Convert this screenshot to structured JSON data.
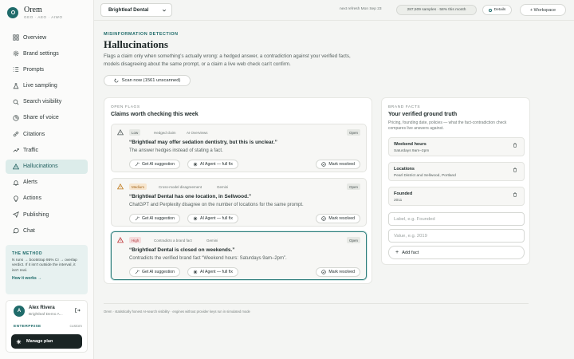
{
  "app": {
    "name": "Orem",
    "subtitle": "GEO · AEO · AIWO"
  },
  "nav": [
    {
      "label": "Overview",
      "icon": "grid-icon"
    },
    {
      "label": "Brand settings",
      "icon": "settings-icon"
    },
    {
      "label": "Prompts",
      "icon": "list-icon"
    },
    {
      "label": "Live sampling",
      "icon": "sampling-icon"
    },
    {
      "label": "Search visibility",
      "icon": "search-icon"
    },
    {
      "label": "Share of voice",
      "icon": "pie-icon"
    },
    {
      "label": "Citations",
      "icon": "link-icon"
    },
    {
      "label": "Traffic",
      "icon": "trend-icon"
    },
    {
      "label": "Hallucinations",
      "icon": "warning-icon",
      "active": true
    },
    {
      "label": "Alerts",
      "icon": "bell-icon"
    },
    {
      "label": "Actions",
      "icon": "bulb-icon"
    },
    {
      "label": "Publishing",
      "icon": "send-icon"
    },
    {
      "label": "Chat",
      "icon": "chat-icon"
    }
  ],
  "method": {
    "title": "THE METHOD",
    "text": "N runs → bootstrap 95% CI → overlap verdict. If it isn't outside the interval, it isn't real.",
    "link": "How it works →"
  },
  "account": {
    "initial": "A",
    "name": "Alex Rivera",
    "org": "Brightleaf Demo A...",
    "plan": "ENTERPRISE",
    "plan_type": "custom",
    "manage_label": "Manage plan"
  },
  "topbar": {
    "brand_selected": "Brightleaf Dental",
    "refresh": "next refresh Mon Sep 23",
    "samples": "287,509 samples · 58% this month",
    "details": "Details",
    "workspace": "+ Workspace"
  },
  "page": {
    "eyebrow": "MISINFORMATION DETECTION",
    "title": "Hallucinations",
    "description": "Flags a claim only when something's actually wrong: a hedged answer, a contradiction against your verified facts, models disagreeing about the same prompt, or a claim a live web check can't confirm.",
    "scan_label": "Scan now (1561 unscanned)"
  },
  "flags": {
    "eyebrow": "OPEN FLAGS",
    "title": "Claims worth checking this week",
    "items": [
      {
        "severity": "Low",
        "type": "Hedged claim",
        "engine": "AI Overviews",
        "status": "Open",
        "claim": "“Brightleaf may offer sedation dentistry, but this is unclear.”",
        "reason": "The answer hedges instead of stating a fact.",
        "suggest_label": "Get AI suggestion",
        "agent_label": "AI Agent — full fix",
        "resolve_label": "Mark resolved",
        "icon_color": "#5a6362"
      },
      {
        "severity": "Medium",
        "type": "Cross-model disagreement",
        "engine": "Gemini",
        "status": "Open",
        "claim": "“Brightleaf Dental has one location, in Sellwood.”",
        "reason": "ChatGPT and Perplexity disagree on the number of locations for the same prompt.",
        "suggest_label": "Get AI suggestion",
        "agent_label": "AI Agent — full fix",
        "resolve_label": "Mark resolved",
        "icon_color": "#c07a1c"
      },
      {
        "severity": "High",
        "type": "Contradicts a brand fact",
        "engine": "Gemini",
        "status": "Open",
        "claim": "“Brightleaf Dental is closed on weekends.”",
        "reason": "Contradicts the verified brand fact “Weekend hours: Saturdays 9am–2pm”.",
        "suggest_label": "Get AI suggestion",
        "agent_label": "AI Agent — full fix",
        "resolve_label": "Mark resolved",
        "icon_color": "#c0393d"
      }
    ]
  },
  "facts": {
    "eyebrow": "BRAND FACTS",
    "title": "Your verified ground truth",
    "description": "Pricing, founding date, policies — what the fact-contradiction check compares live answers against.",
    "items": [
      {
        "label": "Weekend hours",
        "value": "Saturdays 9am–2pm"
      },
      {
        "label": "Locations",
        "value": "Pearl District and Sellwood, Portland"
      },
      {
        "label": "Founded",
        "value": "2011"
      }
    ],
    "label_placeholder": "Label, e.g. Founded",
    "value_placeholder": "Value, e.g. 2019",
    "add_label": "Add fact"
  },
  "footer": "Orem · statistically honest AI-search visibility · engines without provider keys run in simulated mode",
  "colors": {
    "accent": "#1f6b6a",
    "active_nav_bg": "#dcecea"
  }
}
